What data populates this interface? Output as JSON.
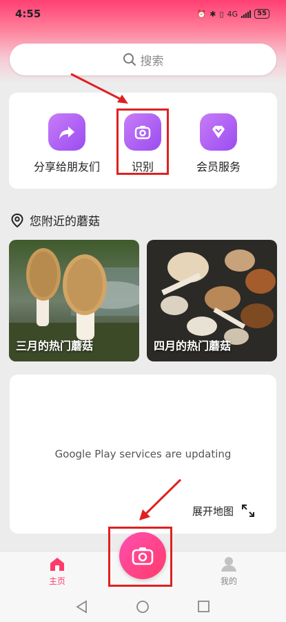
{
  "status_bar": {
    "time": "4:55",
    "network": "4G",
    "battery": "55"
  },
  "search": {
    "placeholder": "搜索"
  },
  "actions": [
    {
      "label": "分享给朋友们",
      "icon": "share-arrow-icon"
    },
    {
      "label": "识别",
      "icon": "camera-icon"
    },
    {
      "label": "会员服务",
      "icon": "vip-diamond-icon"
    }
  ],
  "nearby": {
    "title": "您附近的蘑菇",
    "cards": [
      {
        "label": "三月的热门蘑菇"
      },
      {
        "label": "四月的热门蘑菇"
      }
    ]
  },
  "map": {
    "status_text": "Google Play services are updating",
    "expand_label": "展开地图"
  },
  "bottom_nav": {
    "home_label": "主页",
    "mine_label": "我的"
  },
  "colors": {
    "accent": "#ff3b6b",
    "icon_purple": "#a855f7",
    "annotation_red": "#e02020"
  }
}
